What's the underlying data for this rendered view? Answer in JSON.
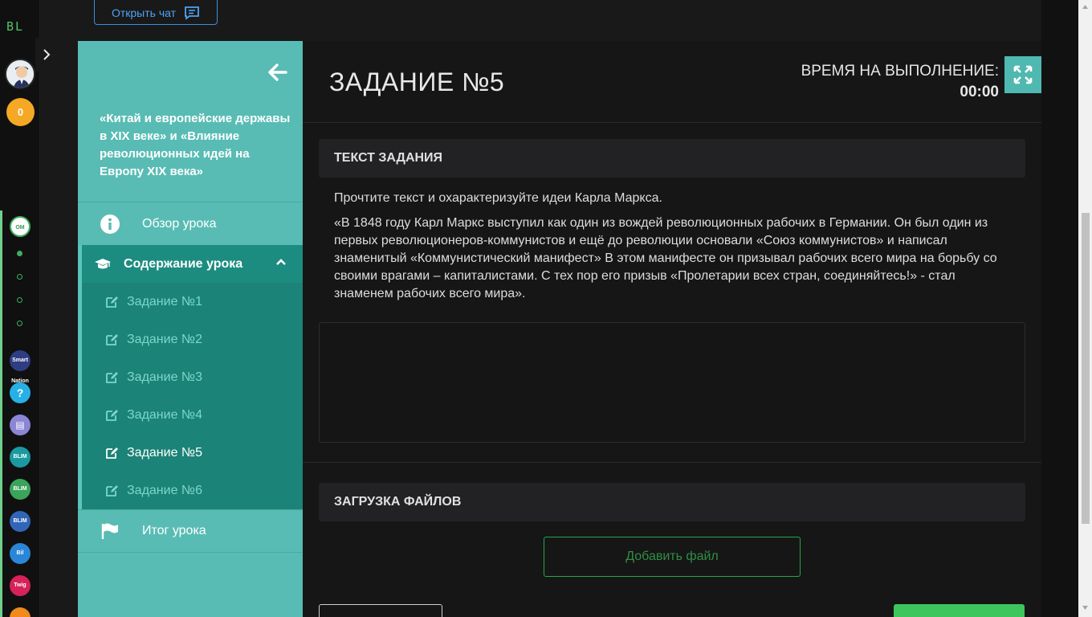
{
  "rail": {
    "logo": "BL",
    "coins": "0",
    "apps": [
      {
        "label": "Smart Nation",
        "color": "#2f3d82"
      },
      {
        "label": "?",
        "color": "#27b0e6"
      },
      {
        "label": "▤",
        "color": "#8b85d6"
      },
      {
        "label": "BLIM",
        "color": "#1a9aa0"
      },
      {
        "label": "BLIM",
        "color": "#3aa55a"
      },
      {
        "label": "BLIM",
        "color": "#3165b8"
      },
      {
        "label": "Bil",
        "color": "#2a86d6"
      },
      {
        "label": "Twig",
        "color": "#d6215b"
      }
    ]
  },
  "header": {
    "chat_button": "Открыть чат"
  },
  "sidebar": {
    "course_title": "«Китай и европейские державы в XIX веке» и «Влияние революционных идей на Европу XIX века»",
    "overview": "Обзор урока",
    "content": "Содержание урока",
    "tasks": [
      "Задание №1",
      "Задание №2",
      "Задание №3",
      "Задание №4",
      "Задание №5",
      "Задание №6"
    ],
    "active_task_index": 4,
    "summary": "Итог урока"
  },
  "main": {
    "title": "ЗАДАНИЕ №5",
    "timer_label": "ВРЕМЯ НА ВЫПОЛНЕНИЕ:",
    "timer_value": "00:00",
    "task_section_title": "ТЕКСТ ЗАДАНИЯ",
    "task_intro": "Прочтите текст и охарактеризуйте идеи Карла Маркса.",
    "task_text": "«В 1848 году Карл Маркс выступил как один из вождей революционных рабочих в Германии. Он был один из первых революционеров-коммунистов и ещё до революции основали «Союз коммунистов» и написал знаменитый «Коммунистический манифест» В этом манифесте он призывал рабочих всего мира на борьбу со своими врагами – капиталистами. С тех пор его призыв «Пролетарии всех стран, соединяйтесь!» - стал знаменем рабочих всего мира».",
    "answer_value": "",
    "upload_section_title": "ЗАГРУЗКА ФАЙЛОВ",
    "add_file_button": "Добавить файл"
  },
  "colors": {
    "sidebar_bg": "#58bcb4",
    "sidebar_active": "#1b8378",
    "accent_green": "#3cc65c",
    "chat_blue": "#3a8fe0"
  }
}
